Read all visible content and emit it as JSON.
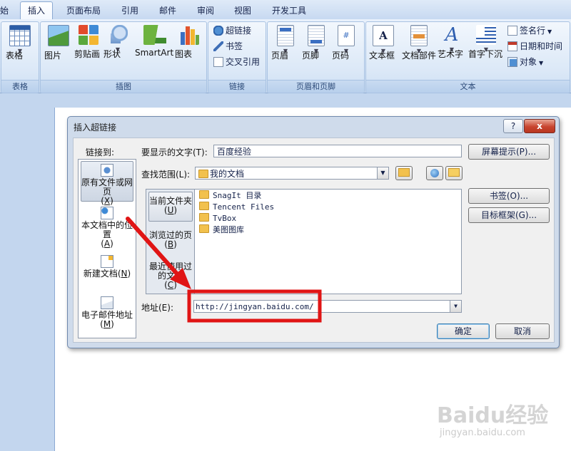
{
  "tabs": [
    "始",
    "插入",
    "页面布局",
    "引用",
    "邮件",
    "审阅",
    "视图",
    "开发工具"
  ],
  "ribbon": {
    "groups": {
      "table": "表格",
      "illustrations": "插图",
      "links": "链接",
      "header_footer": "页眉和页脚",
      "text": "文本"
    },
    "table_btn": "表格",
    "picture_btn": "图片",
    "clipart_btn": "剪贴画",
    "shapes_btn": "形状",
    "smartart_btn": "SmartArt",
    "chart_btn": "图表",
    "hyperlink_btn": "超链接",
    "bookmark_btn": "书签",
    "crossref_btn": "交叉引用",
    "header_btn": "页眉",
    "footer_btn": "页脚",
    "pagenum_btn": "页码",
    "textbox_btn": "文本框",
    "quickparts_btn": "文档部件",
    "wordart_btn": "艺术字",
    "dropcap_btn": "首字下沉",
    "signature_btn": "签名行",
    "datetime_btn": "日期和时间",
    "object_btn": "对象"
  },
  "dialog": {
    "title": "插入超链接",
    "help": "?",
    "close": "x",
    "link_to_label": "链接到:",
    "nav": {
      "existing_file": "原有文件或网页",
      "existing_file_key": "X",
      "place_in_doc": "本文档中的位置",
      "place_in_doc_key": "A",
      "new_doc": "新建文档",
      "new_doc_key": "N",
      "email": "电子邮件地址",
      "email_key": "M"
    },
    "text_to_display_label": "要显示的文字(T):",
    "text_to_display_value": "百度经验",
    "screentip_btn": "屏幕提示(P)...",
    "look_in_label": "查找范围(L):",
    "look_in_value": "我的文档",
    "side": {
      "current_folder": "当前文件夹",
      "current_folder_key": "U",
      "browsed_pages": "浏览过的页",
      "browsed_pages_key": "B",
      "recent_files": "最近使用过的文件",
      "recent_files_key": "C"
    },
    "files": [
      "SnagIt 目录",
      "Tencent Files",
      "TvBox",
      "美图图库"
    ],
    "bookmark_btn": "书签(O)...",
    "target_frame_btn": "目标框架(G)...",
    "address_label": "地址(E):",
    "address_value": "http://jingyan.baidu.com/",
    "ok_btn": "确定",
    "cancel_btn": "取消"
  },
  "watermark": {
    "brand": "Baidu经验",
    "url": "jingyan.baidu.com"
  },
  "colors": {
    "highlight_box": "#e01515",
    "arrow": "#e01515"
  }
}
